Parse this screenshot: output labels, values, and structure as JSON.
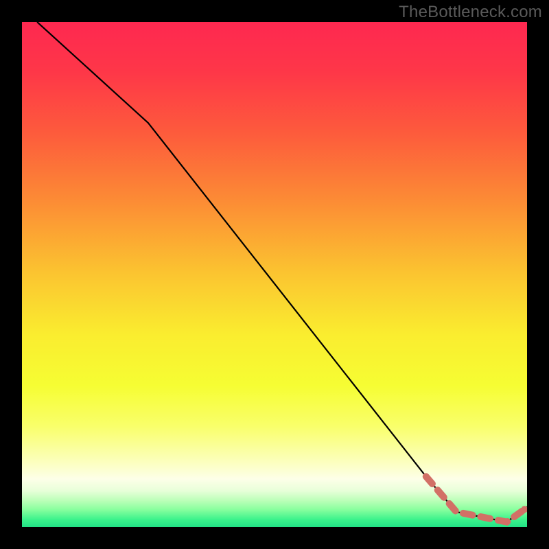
{
  "watermark": "TheBottleneck.com",
  "chart_data": {
    "type": "line",
    "title": "",
    "xlabel": "",
    "ylabel": "",
    "xlim": [
      0,
      100
    ],
    "ylim": [
      0,
      100
    ],
    "grid": false,
    "series": [
      {
        "name": "main-curve",
        "style": "solid",
        "color": "#000000",
        "x": [
          3,
          25,
          80,
          86,
          96,
          100
        ],
        "y": [
          100,
          80,
          10,
          3,
          1,
          4
        ]
      },
      {
        "name": "highlight-dashed",
        "style": "dashed-thick",
        "color": "#d27066",
        "x": [
          80,
          86,
          96,
          99.5
        ],
        "y": [
          10,
          3,
          1,
          3.5
        ]
      }
    ],
    "background_gradient": {
      "stops": [
        {
          "offset": 0.0,
          "color": "#fe2850"
        },
        {
          "offset": 0.1,
          "color": "#fe3748"
        },
        {
          "offset": 0.22,
          "color": "#fd5b3c"
        },
        {
          "offset": 0.35,
          "color": "#fc8a35"
        },
        {
          "offset": 0.5,
          "color": "#fbc530"
        },
        {
          "offset": 0.62,
          "color": "#faed2f"
        },
        {
          "offset": 0.72,
          "color": "#f6fd33"
        },
        {
          "offset": 0.8,
          "color": "#f9ff6a"
        },
        {
          "offset": 0.86,
          "color": "#fbffb0"
        },
        {
          "offset": 0.905,
          "color": "#fdffe8"
        },
        {
          "offset": 0.928,
          "color": "#e8ffd9"
        },
        {
          "offset": 0.948,
          "color": "#baffb8"
        },
        {
          "offset": 0.965,
          "color": "#8aff9f"
        },
        {
          "offset": 0.985,
          "color": "#3cf38c"
        },
        {
          "offset": 1.0,
          "color": "#22e286"
        }
      ]
    }
  }
}
